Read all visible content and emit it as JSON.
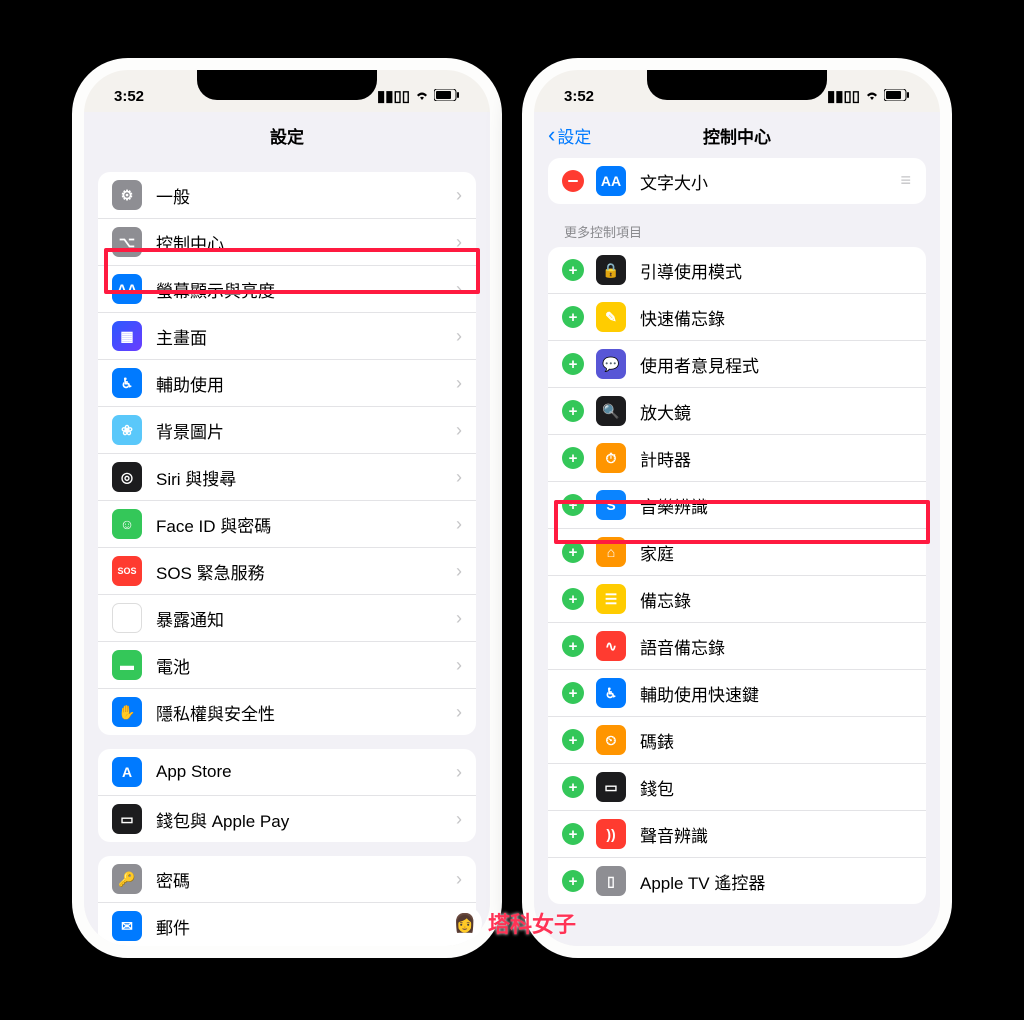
{
  "status": {
    "time": "3:52"
  },
  "left": {
    "title": "設定",
    "group1": [
      {
        "label": "一般",
        "iconText": "⚙︎",
        "iconClass": "bg-gray"
      },
      {
        "label": "控制中心",
        "iconText": "⌥",
        "iconClass": "bg-gray"
      },
      {
        "label": "螢幕顯示與亮度",
        "iconText": "AA",
        "iconClass": "bg-blue"
      },
      {
        "label": "主畫面",
        "iconText": "▦",
        "iconClass": "bg-grid"
      },
      {
        "label": "輔助使用",
        "iconText": "♿︎",
        "iconClass": "bg-blue"
      },
      {
        "label": "背景圖片",
        "iconText": "❀",
        "iconClass": "bg-cyan"
      },
      {
        "label": "Siri 與搜尋",
        "iconText": "◎",
        "iconClass": "bg-dark"
      },
      {
        "label": "Face ID 與密碼",
        "iconText": "☺︎",
        "iconClass": "bg-green"
      },
      {
        "label": "SOS 緊急服務",
        "iconText": "SOS",
        "iconClass": "bg-red"
      },
      {
        "label": "暴露通知",
        "iconText": "✺",
        "iconClass": "bg-dotred"
      },
      {
        "label": "電池",
        "iconText": "▬",
        "iconClass": "bg-green"
      },
      {
        "label": "隱私權與安全性",
        "iconText": "✋",
        "iconClass": "bg-blue"
      }
    ],
    "group2": [
      {
        "label": "App Store",
        "iconText": "A",
        "iconClass": "bg-blue"
      },
      {
        "label": "錢包與 Apple Pay",
        "iconText": "▭",
        "iconClass": "bg-dark"
      }
    ],
    "group3": [
      {
        "label": "密碼",
        "iconText": "🔑",
        "iconClass": "bg-gray"
      },
      {
        "label": "郵件",
        "iconText": "✉︎",
        "iconClass": "bg-blue"
      }
    ]
  },
  "right": {
    "back": "設定",
    "title": "控制中心",
    "included": {
      "label": "文字大小",
      "iconText": "AA",
      "iconClass": "bg-blue"
    },
    "sectionHeader": "更多控制項目",
    "more": [
      {
        "label": "引導使用模式",
        "iconText": "🔒",
        "iconClass": "bg-dark"
      },
      {
        "label": "快速備忘錄",
        "iconText": "✎",
        "iconClass": "bg-yellow"
      },
      {
        "label": "使用者意見程式",
        "iconText": "💬",
        "iconClass": "bg-purple"
      },
      {
        "label": "放大鏡",
        "iconText": "🔍",
        "iconClass": "bg-dark"
      },
      {
        "label": "計時器",
        "iconText": "⏱",
        "iconClass": "bg-orange"
      },
      {
        "label": "音樂辨識",
        "iconText": "S",
        "iconClass": "bg-shazam"
      },
      {
        "label": "家庭",
        "iconText": "⌂",
        "iconClass": "bg-orange"
      },
      {
        "label": "備忘錄",
        "iconText": "☰",
        "iconClass": "bg-yellow"
      },
      {
        "label": "語音備忘錄",
        "iconText": "∿",
        "iconClass": "bg-red"
      },
      {
        "label": "輔助使用快速鍵",
        "iconText": "♿︎",
        "iconClass": "bg-blue"
      },
      {
        "label": "碼錶",
        "iconText": "⏲",
        "iconClass": "bg-orange"
      },
      {
        "label": "錢包",
        "iconText": "▭",
        "iconClass": "bg-dark"
      },
      {
        "label": "聲音辨識",
        "iconText": "))",
        "iconClass": "bg-red"
      },
      {
        "label": "Apple TV 遙控器",
        "iconText": "▯",
        "iconClass": "bg-gray"
      }
    ]
  },
  "watermark": "塔科女子"
}
